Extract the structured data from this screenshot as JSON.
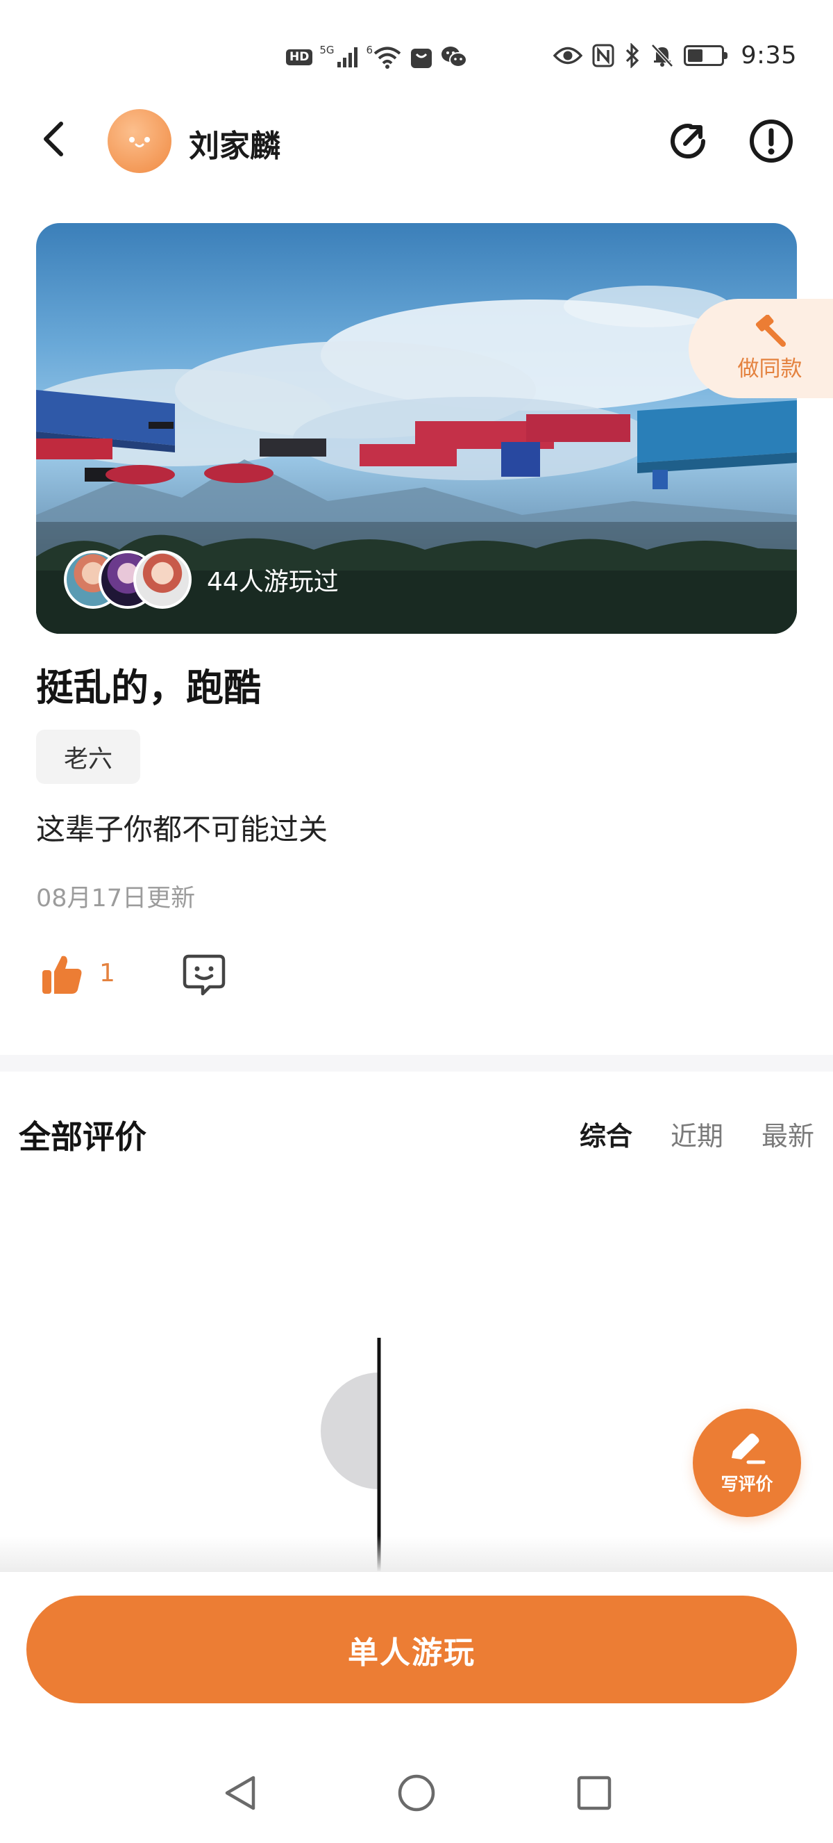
{
  "status_bar": {
    "hd_badge": "HD",
    "network_label": "5G",
    "wifi_label": "6",
    "time": "9:35",
    "battery_level": 0.45,
    "icons": [
      "signal-icon",
      "wifi-icon",
      "shopping-bag-icon",
      "wechat-icon",
      "eye-icon",
      "nfc-icon",
      "bluetooth-icon",
      "bell-muted-icon",
      "battery-icon"
    ]
  },
  "header": {
    "author_name": "刘家麟",
    "icons": [
      "back-arrow-icon",
      "share-icon",
      "report-icon"
    ]
  },
  "cover": {
    "played_count_text": "44人游玩过",
    "remix_label": "做同款"
  },
  "game": {
    "title": "挺乱的，跑酷",
    "tag": "老六",
    "description": "这辈子你都不可能过关",
    "updated": "08月17日更新",
    "like_count": "1"
  },
  "reviews": {
    "title": "全部评价",
    "sort_tabs": [
      "综合",
      "近期",
      "最新"
    ],
    "active_tab": "综合",
    "write_label": "写评价"
  },
  "bottom": {
    "play_label": "单人游玩"
  },
  "colors": {
    "accent": "#ec7d34",
    "accent_light": "#fdeee3",
    "text_primary": "#1a1a1a",
    "text_muted": "#9c9c9c"
  }
}
